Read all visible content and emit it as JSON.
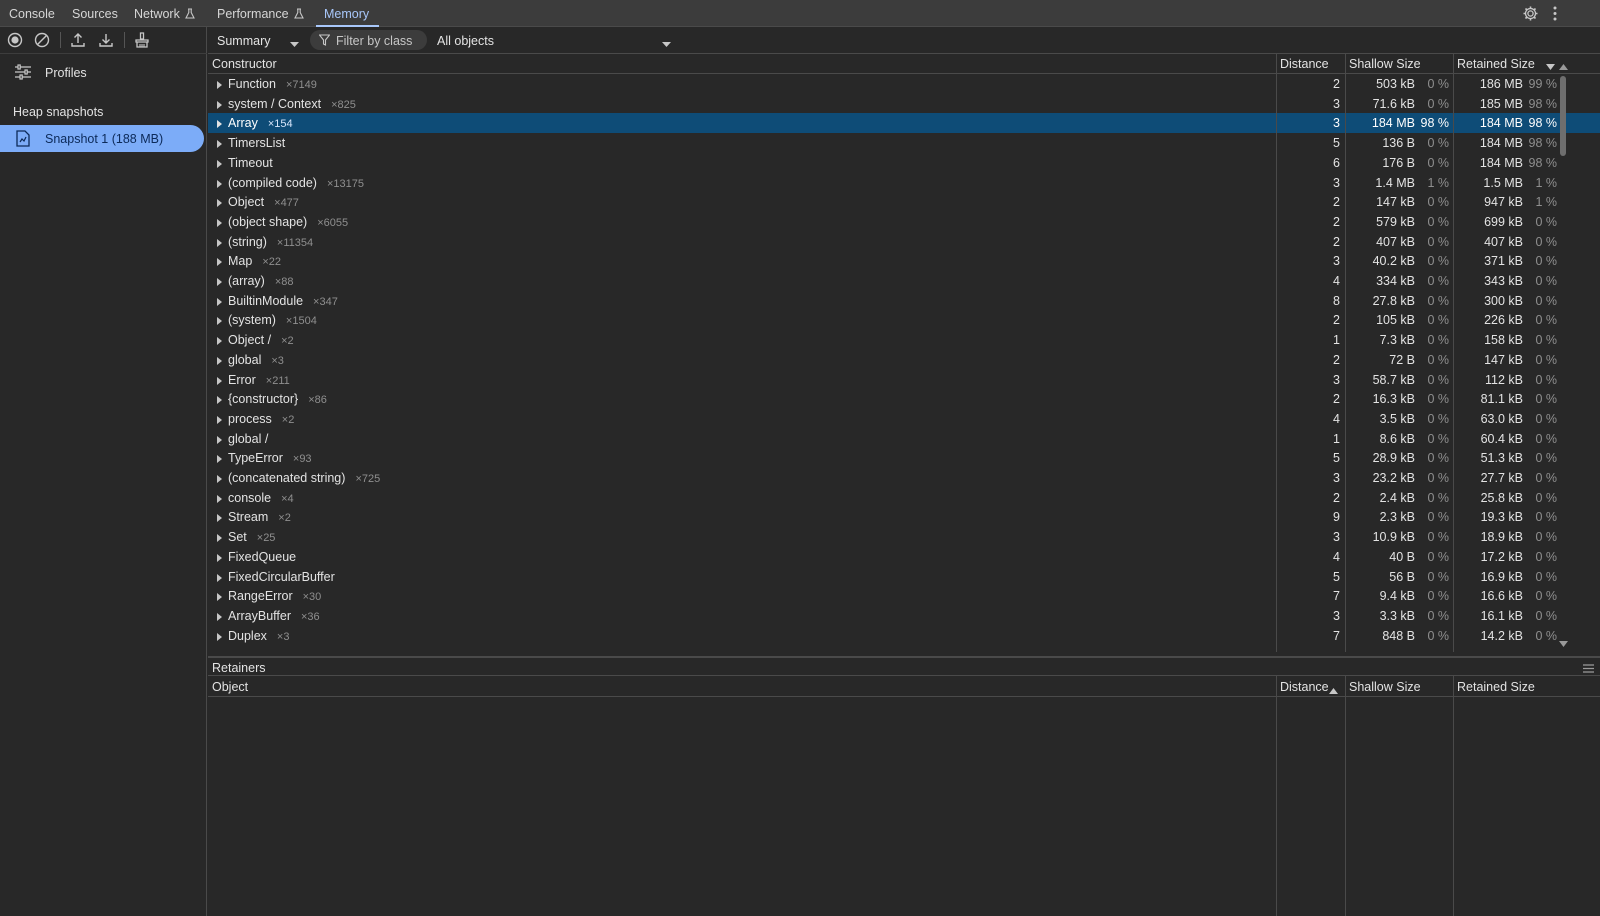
{
  "tabs": [
    {
      "label": "Console",
      "flask": false,
      "active": false
    },
    {
      "label": "Sources",
      "flask": false,
      "active": false
    },
    {
      "label": "Network",
      "flask": true,
      "active": false
    },
    {
      "label": "Performance",
      "flask": true,
      "active": false
    },
    {
      "label": "Memory",
      "flask": false,
      "active": true
    }
  ],
  "sidebar": {
    "profiles_label": "Profiles",
    "heap_title": "Heap snapshots",
    "snapshot_label": "Snapshot 1 (188 MB)"
  },
  "toolbar": {
    "view_select": "Summary",
    "filter_placeholder": "Filter by class",
    "objects_select": "All objects"
  },
  "grid": {
    "headers": {
      "constructor": "Constructor",
      "distance": "Distance",
      "shallow": "Shallow Size",
      "retained": "Retained Size"
    },
    "sort_indicator": "descending",
    "rows": [
      {
        "name": "Function",
        "count": "×7149",
        "distance": "2",
        "shallow": "503 kB",
        "shallow_pct": "0 %",
        "retained": "186 MB",
        "retained_pct": "99 %"
      },
      {
        "name": "system / Context",
        "count": "×825",
        "distance": "3",
        "shallow": "71.6 kB",
        "shallow_pct": "0 %",
        "retained": "185 MB",
        "retained_pct": "98 %"
      },
      {
        "name": "Array",
        "count": "×154",
        "distance": "3",
        "shallow": "184 MB",
        "shallow_pct": "98 %",
        "retained": "184 MB",
        "retained_pct": "98 %",
        "selected": true
      },
      {
        "name": "TimersList",
        "count": "",
        "distance": "5",
        "shallow": "136 B",
        "shallow_pct": "0 %",
        "retained": "184 MB",
        "retained_pct": "98 %"
      },
      {
        "name": "Timeout",
        "count": "",
        "distance": "6",
        "shallow": "176 B",
        "shallow_pct": "0 %",
        "retained": "184 MB",
        "retained_pct": "98 %"
      },
      {
        "name": "(compiled code)",
        "count": "×13175",
        "distance": "3",
        "shallow": "1.4 MB",
        "shallow_pct": "1 %",
        "retained": "1.5 MB",
        "retained_pct": "1 %"
      },
      {
        "name": "Object",
        "count": "×477",
        "distance": "2",
        "shallow": "147 kB",
        "shallow_pct": "0 %",
        "retained": "947 kB",
        "retained_pct": "1 %"
      },
      {
        "name": "(object shape)",
        "count": "×6055",
        "distance": "2",
        "shallow": "579 kB",
        "shallow_pct": "0 %",
        "retained": "699 kB",
        "retained_pct": "0 %"
      },
      {
        "name": "(string)",
        "count": "×11354",
        "distance": "2",
        "shallow": "407 kB",
        "shallow_pct": "0 %",
        "retained": "407 kB",
        "retained_pct": "0 %"
      },
      {
        "name": "Map",
        "count": "×22",
        "distance": "3",
        "shallow": "40.2 kB",
        "shallow_pct": "0 %",
        "retained": "371 kB",
        "retained_pct": "0 %"
      },
      {
        "name": "(array)",
        "count": "×88",
        "distance": "4",
        "shallow": "334 kB",
        "shallow_pct": "0 %",
        "retained": "343 kB",
        "retained_pct": "0 %"
      },
      {
        "name": "BuiltinModule",
        "count": "×347",
        "distance": "8",
        "shallow": "27.8 kB",
        "shallow_pct": "0 %",
        "retained": "300 kB",
        "retained_pct": "0 %"
      },
      {
        "name": "(system)",
        "count": "×1504",
        "distance": "2",
        "shallow": "105 kB",
        "shallow_pct": "0 %",
        "retained": "226 kB",
        "retained_pct": "0 %"
      },
      {
        "name": "Object /",
        "count": "×2",
        "distance": "1",
        "shallow": "7.3 kB",
        "shallow_pct": "0 %",
        "retained": "158 kB",
        "retained_pct": "0 %"
      },
      {
        "name": "global",
        "count": "×3",
        "distance": "2",
        "shallow": "72 B",
        "shallow_pct": "0 %",
        "retained": "147 kB",
        "retained_pct": "0 %"
      },
      {
        "name": "Error",
        "count": "×211",
        "distance": "3",
        "shallow": "58.7 kB",
        "shallow_pct": "0 %",
        "retained": "112 kB",
        "retained_pct": "0 %"
      },
      {
        "name": "{constructor}",
        "count": "×86",
        "distance": "2",
        "shallow": "16.3 kB",
        "shallow_pct": "0 %",
        "retained": "81.1 kB",
        "retained_pct": "0 %"
      },
      {
        "name": "process",
        "count": "×2",
        "distance": "4",
        "shallow": "3.5 kB",
        "shallow_pct": "0 %",
        "retained": "63.0 kB",
        "retained_pct": "0 %"
      },
      {
        "name": "global /",
        "count": "",
        "distance": "1",
        "shallow": "8.6 kB",
        "shallow_pct": "0 %",
        "retained": "60.4 kB",
        "retained_pct": "0 %"
      },
      {
        "name": "TypeError",
        "count": "×93",
        "distance": "5",
        "shallow": "28.9 kB",
        "shallow_pct": "0 %",
        "retained": "51.3 kB",
        "retained_pct": "0 %"
      },
      {
        "name": "(concatenated string)",
        "count": "×725",
        "distance": "3",
        "shallow": "23.2 kB",
        "shallow_pct": "0 %",
        "retained": "27.7 kB",
        "retained_pct": "0 %"
      },
      {
        "name": "console",
        "count": "×4",
        "distance": "2",
        "shallow": "2.4 kB",
        "shallow_pct": "0 %",
        "retained": "25.8 kB",
        "retained_pct": "0 %"
      },
      {
        "name": "Stream",
        "count": "×2",
        "distance": "9",
        "shallow": "2.3 kB",
        "shallow_pct": "0 %",
        "retained": "19.3 kB",
        "retained_pct": "0 %"
      },
      {
        "name": "Set",
        "count": "×25",
        "distance": "3",
        "shallow": "10.9 kB",
        "shallow_pct": "0 %",
        "retained": "18.9 kB",
        "retained_pct": "0 %"
      },
      {
        "name": "FixedQueue",
        "count": "",
        "distance": "4",
        "shallow": "40 B",
        "shallow_pct": "0 %",
        "retained": "17.2 kB",
        "retained_pct": "0 %"
      },
      {
        "name": "FixedCircularBuffer",
        "count": "",
        "distance": "5",
        "shallow": "56 B",
        "shallow_pct": "0 %",
        "retained": "16.9 kB",
        "retained_pct": "0 %"
      },
      {
        "name": "RangeError",
        "count": "×30",
        "distance": "7",
        "shallow": "9.4 kB",
        "shallow_pct": "0 %",
        "retained": "16.6 kB",
        "retained_pct": "0 %"
      },
      {
        "name": "ArrayBuffer",
        "count": "×36",
        "distance": "3",
        "shallow": "3.3 kB",
        "shallow_pct": "0 %",
        "retained": "16.1 kB",
        "retained_pct": "0 %"
      },
      {
        "name": "Duplex",
        "count": "×3",
        "distance": "7",
        "shallow": "848 B",
        "shallow_pct": "0 %",
        "retained": "14.2 kB",
        "retained_pct": "0 %"
      }
    ]
  },
  "retainers": {
    "title": "Retainers",
    "headers": {
      "object": "Object",
      "distance": "Distance",
      "shallow": "Shallow Size",
      "retained": "Retained Size"
    },
    "sort_indicator": "ascending"
  },
  "colors": {
    "accent": "#a8c7fa",
    "selected_row": "#0e4c77",
    "snapshot_pill": "#7cacf8"
  }
}
